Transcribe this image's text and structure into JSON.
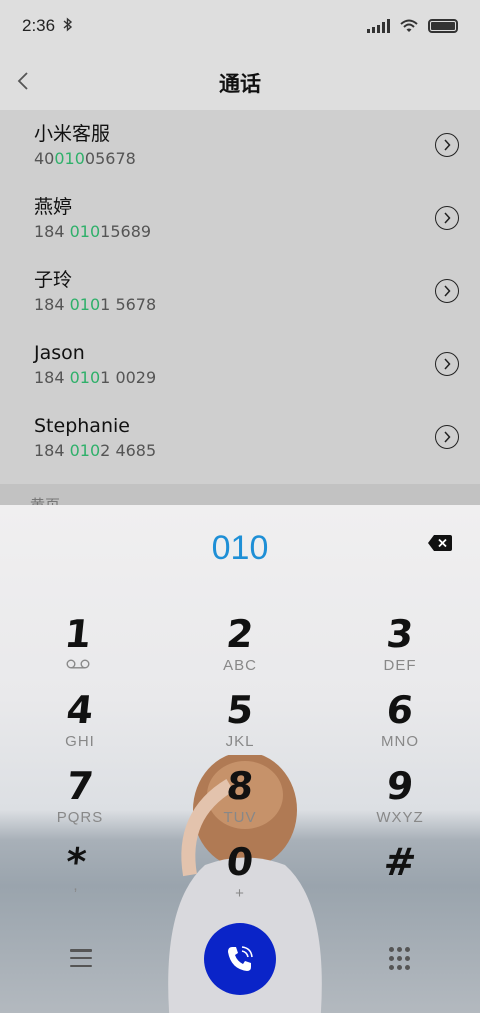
{
  "status_bar": {
    "time": "2:36"
  },
  "header": {
    "title": "通话"
  },
  "contacts": [
    {
      "name": "小米客服",
      "number_pre": "40",
      "number_match": "010",
      "number_post": "05678"
    },
    {
      "name": "燕婷",
      "number_pre": "184 ",
      "number_match": "010",
      "number_post": "15689"
    },
    {
      "name": "子玲",
      "number_pre": "184 ",
      "number_match": "010",
      "number_post": "1 5678"
    },
    {
      "name": "Jason",
      "number_pre": "184 ",
      "number_match": "010",
      "number_post": "1 0029"
    },
    {
      "name": "Stephanie",
      "number_pre": "184 ",
      "number_match": "010",
      "number_post": "2 4685"
    }
  ],
  "section_label": "黄页",
  "dialer": {
    "dialed_number": "010",
    "keys": [
      {
        "digit": "1",
        "sub": ""
      },
      {
        "digit": "2",
        "sub": "ABC"
      },
      {
        "digit": "3",
        "sub": "DEF"
      },
      {
        "digit": "4",
        "sub": "GHI"
      },
      {
        "digit": "5",
        "sub": "JKL"
      },
      {
        "digit": "6",
        "sub": "MNO"
      },
      {
        "digit": "7",
        "sub": "PQRS"
      },
      {
        "digit": "8",
        "sub": "TUV"
      },
      {
        "digit": "9",
        "sub": "WXYZ"
      },
      {
        "digit": "*",
        "sub": ","
      },
      {
        "digit": "0",
        "sub": "+"
      },
      {
        "digit": "#",
        "sub": ""
      }
    ]
  },
  "colors": {
    "accent_blue": "#1e8fd6",
    "match_green": "#2fb06a",
    "call_button": "#0a24c8"
  },
  "icons": [
    "bluetooth-icon",
    "signal-icon",
    "wifi-icon",
    "battery-icon",
    "back-icon",
    "chevron-right-circle-icon",
    "backspace-icon",
    "voicemail-icon",
    "menu-icon",
    "phone-icon",
    "keypad-icon"
  ]
}
